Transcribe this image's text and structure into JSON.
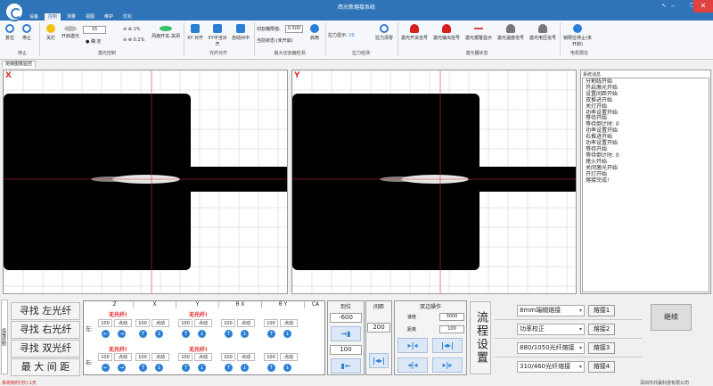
{
  "app": {
    "title": "西光新熔接系统"
  },
  "menu": [
    "设备",
    "控制",
    "测量",
    "视图",
    "维护",
    "优化"
  ],
  "ribbon": {
    "buttons": [
      {
        "id": "reset",
        "label": "复位",
        "icon": "power-ring-icon"
      },
      {
        "id": "stop",
        "label": "停止",
        "icon": "stop-ring-icon"
      },
      {
        "id": "lamp",
        "label": "关灯",
        "icon": "lamp-icon"
      },
      {
        "id": "laser-on",
        "label": "开启激光",
        "icon": "toggle-icon"
      },
      {
        "id": "fan",
        "label": "风扇开关-关闭",
        "icon": "toggle-on-icon"
      },
      {
        "id": "xy-align",
        "label": "XY 对齐",
        "icon": "xy-align-icon"
      },
      {
        "id": "xyb-align",
        "label": "XY中当对齐",
        "icon": "xy-center-icon"
      },
      {
        "id": "auto-align",
        "label": "自动对中",
        "icon": "auto-align-icon"
      },
      {
        "id": "enable",
        "label": "启用",
        "icon": "check-icon"
      },
      {
        "id": "tension-clear",
        "label": "拉力清零",
        "icon": "refresh-icon"
      },
      {
        "id": "laser-sig",
        "label": "激光开关信号",
        "icon": "alarm-red-icon"
      },
      {
        "id": "laser-out",
        "label": "激光输出信号",
        "icon": "alarm-red-icon"
      },
      {
        "id": "laser-alarm",
        "label": "激光报警显示",
        "icon": "alarm-dash-icon"
      },
      {
        "id": "temp-sig",
        "label": "激光温度信号",
        "icon": "alarm-grey-icon"
      },
      {
        "id": "volt-sig",
        "label": "激光电压信号",
        "icon": "alarm-grey-icon"
      },
      {
        "id": "lock",
        "label": "锁限位停止(未开启)",
        "icon": "lock-check-icon"
      }
    ],
    "groups": [
      "停止",
      "激光控制",
      "光纤对齐",
      "最大切割偏检测",
      "拉力检测",
      "激光器状态",
      "电机限位"
    ],
    "power_value": "15",
    "power_step": "1%",
    "power_step2": "0.1%",
    "confirm_label": "确 定",
    "cut_threshold_label": "切割偏限值:",
    "cut_threshold_value": "0.500",
    "cut_state_label": "当前状态:(未开启)",
    "tension_label": "拉力显示:",
    "tension_value": "20"
  },
  "view_tab": "熔接图像监控",
  "views": [
    {
      "axis": "X"
    },
    {
      "axis": "Y"
    }
  ],
  "log": {
    "header": "系统消息",
    "lines": [
      "分割线开始",
      "开启激光开始",
      "设置间距开始",
      "双推进开始",
      "关灯开始",
      "功率设置开始",
      "等待开始",
      "等待倒计时: 0",
      "功率设置开始",
      "右推进开始",
      "功率设置开始",
      "等待开始",
      "等待倒计时: 0",
      "熄火开始",
      "关闭激光开始",
      "开灯开始",
      "熔接完成!"
    ]
  },
  "side_tab": "熔接控制",
  "find_buttons": [
    "寻找 左光纤",
    "寻找 右光纤",
    "寻找 双光纤",
    "最 大 间 距"
  ],
  "axes_grid": {
    "headers": [
      "Z",
      "X",
      "Y",
      "θ X",
      "θ Y",
      "CA"
    ],
    "rows": [
      {
        "label": "左:",
        "warn": [
          "无光纤!",
          "无光纤!"
        ]
      },
      {
        "label": "右:",
        "warn": [
          "无光纤!",
          "无光纤!"
        ]
      }
    ],
    "step_value": "100",
    "jog_label": "点动"
  },
  "position": {
    "header": "到位",
    "value": "-600",
    "value2": "100"
  },
  "gap": {
    "header": "间距",
    "value": "200"
  },
  "dual": {
    "header": "双边操作",
    "speed_label": "速度",
    "speed_value": "3000",
    "dist_label": "距离",
    "dist_value": "100"
  },
  "process": {
    "label": "流程设置",
    "recipes": [
      {
        "select": "8mm端帽熔接",
        "button": "熔接1"
      },
      {
        "select": "功率校正",
        "button": "熔接2"
      },
      {
        "select": "880/1050光纤熔接",
        "button": "熔接3"
      },
      {
        "select": "310/460光纤熔接",
        "button": "熔接4"
      }
    ],
    "continue": "继续"
  },
  "status": {
    "left": "系统耗时(秒):1天",
    "right": "深圳市共赢科技有限公司"
  }
}
